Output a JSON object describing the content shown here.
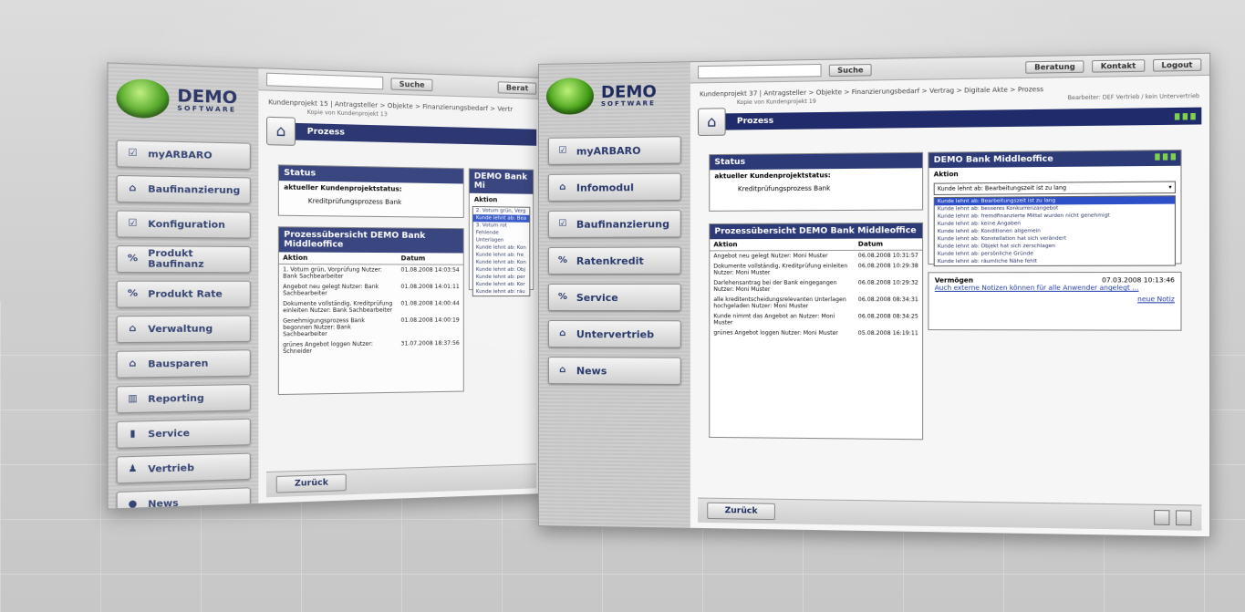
{
  "logo": {
    "main": "DEMO",
    "sub": "SOFTWARE"
  },
  "back_window": {
    "nav": [
      "myARBARO",
      "Baufinanzierung",
      "Konfiguration",
      "Produkt Baufinanz",
      "Produkt Rate",
      "Verwaltung",
      "Bausparen",
      "Reporting",
      "Service",
      "Vertrieb",
      "News"
    ],
    "top": {
      "search_btn": "Suche",
      "right_btn": "Berat"
    },
    "breadcrumb": "Kundenprojekt 15 | Antragsteller > Objekte > Finanzierungsbedarf > Vertr",
    "subnote": "Kopie von Kundenprojekt 13",
    "process_title": "Prozess",
    "status": {
      "header": "Status",
      "label": "aktueller Kundenprojektstatus:",
      "value": "Kreditprüfungsprozess Bank"
    },
    "side_panel": {
      "header": "DEMO Bank Mi",
      "col": "Aktion",
      "rows": [
        "2. Votum grün, Verg",
        "Kunde lehnt ab: Bea",
        "3. Votum rot Fehlende Unterlagen",
        "Kunde lehnt ab: Kon",
        "Kunde lehnt ab: fre",
        "Kunde lehnt ab: Kon",
        "Kunde lehnt ab: Obj",
        "Kunde lehnt ab: per",
        "Kunde lehnt ab: Kor",
        "Kunde lehnt ab: räu"
      ]
    },
    "overview": {
      "header": "Prozessübersicht DEMO Bank Middleoffice",
      "col_action": "Aktion",
      "col_date": "Datum",
      "rows": [
        {
          "a": "1. Votum grün, Vorprüfung Nutzer: Bank Sachbearbeiter",
          "d": "01.08.2008 14:03:54"
        },
        {
          "a": "Angebot neu gelegt Nutzer: Bank Sachbearbeiter",
          "d": "01.08.2008 14:01:11"
        },
        {
          "a": "Dokumente vollständig, Kreditprüfung einleiten Nutzer: Bank Sachbearbeiter",
          "d": "01.08.2008 14:00:44"
        },
        {
          "a": "Genehmigungsprozess Bank begonnen Nutzer: Bank Sachbearbeiter",
          "d": "01.08.2008 14:00:19"
        },
        {
          "a": "grünes Angebot loggen Nutzer: Schneider",
          "d": "31.07.2008 18:37:56"
        }
      ]
    },
    "back_button": "Zurück"
  },
  "front_window": {
    "nav": [
      "myARBARO",
      "Infomodul",
      "Baufinanzierung",
      "Ratenkredit",
      "Service",
      "Untervertrieb",
      "News"
    ],
    "top": {
      "search_btn": "Suche",
      "btn1": "Beratung",
      "btn2": "Kontakt",
      "btn3": "Logout"
    },
    "breadcrumb": "Kundenprojekt 37 | Antragsteller > Objekte > Finanzierungsbedarf > Vertrag > Digitale Akte > Prozess",
    "subnote_left": "Kopie von Kundenprojekt 19",
    "subnote_right": "Bearbeiter: DEF Vertrieb / kein Untervertrieb",
    "process_title": "Prozess",
    "status": {
      "header": "Status",
      "label": "aktueller Kundenprojektstatus:",
      "value": "Kreditprüfungsprozess Bank"
    },
    "middleoffice": {
      "header": "DEMO Bank Middleoffice",
      "col": "Aktion",
      "selected": "Kunde lehnt ab: Bearbeitungszeit ist zu lang",
      "options": [
        "Kunde lehnt ab: Bearbeitungszeit ist zu lang",
        "Kunde lehnt ab: besseres Konkurrenzangebot",
        "Kunde lehnt ab: fremdfinanzierte Mittel wurden nicht genehmigt",
        "Kunde lehnt ab: keine Angaben",
        "Kunde lehnt ab: Konditionen allgemein",
        "Kunde lehnt ab: Konstellation hat sich verändert",
        "Kunde lehnt ab: Objekt hat sich zerschlagen",
        "Kunde lehnt ab: persönliche Gründe",
        "Kunde lehnt ab: räumliche Nähe fehlt"
      ]
    },
    "vermoegen": {
      "title": "Vermögen",
      "date": "07.03.2008 10:13:46",
      "link": "Auch externe Notizen können für alle Anwender angelegt ...",
      "new_note": "neue Notiz"
    },
    "overview": {
      "header": "Prozessübersicht DEMO Bank Middleoffice",
      "col_action": "Aktion",
      "col_date": "Datum",
      "rows": [
        {
          "a": "Angebot neu gelegt Nutzer: Moni Muster",
          "d": "06.08.2008 10:31:57"
        },
        {
          "a": "Dokumente vollständig, Kreditprüfung einleiten Nutzer: Moni Muster",
          "d": "06.08.2008 10:29:38"
        },
        {
          "a": "Darlehensantrag bei der Bank eingegangen Nutzer: Moni Muster",
          "d": "06.08.2008 10:29:32"
        },
        {
          "a": "alle kreditentscheidungsrelevanten Unterlagen hochgeladen Nutzer: Moni Muster",
          "d": "06.08.2008 08:34:31"
        },
        {
          "a": "Kunde nimmt das Angebot an Nutzer: Moni Muster",
          "d": "06.08.2008 08:34:25"
        },
        {
          "a": "grünes Angebot loggen Nutzer: Moni Muster",
          "d": "05.08.2008 16:19:11"
        }
      ]
    },
    "back_button": "Zurück"
  },
  "colors": {
    "navy": "#1f2b6a",
    "panel_header": "#2c3a78",
    "logo_green": "#4aa41c"
  }
}
